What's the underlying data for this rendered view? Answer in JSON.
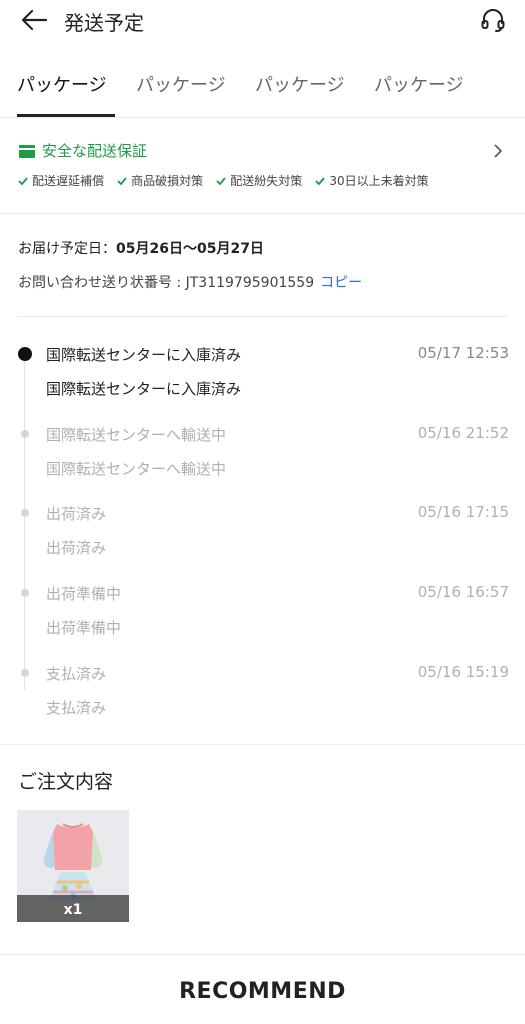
{
  "header": {
    "title": "発送予定",
    "back_icon": "arrow-left-icon",
    "support_icon": "headset-icon"
  },
  "tabs": [
    {
      "label": "パッケージ",
      "active": true
    },
    {
      "label": "パッケージ",
      "active": false
    },
    {
      "label": "パッケージ",
      "active": false
    },
    {
      "label": "パッケージ",
      "active": false
    }
  ],
  "guarantee": {
    "title": "安全な配送保証",
    "accent_color": "#1f9a45",
    "items": [
      "配送遅延補償",
      "商品破損対策",
      "配送紛失対策",
      "30日以上未着対策"
    ]
  },
  "delivery": {
    "estimate_label": "お届け予定日：",
    "estimate_date": "05月26日〜05月27日",
    "tracking_label": "お問い合わせ送り状番号 : ",
    "tracking_number": "JT3119795901559",
    "copy_label": "コピー",
    "link_color": "#2a6fd6"
  },
  "timeline": [
    {
      "status": "国際転送センターに入庫済み",
      "time": "05/17 12:53",
      "detail": "国際転送センターに入庫済み",
      "active": true
    },
    {
      "status": "国際転送センターへ輸送中",
      "time": "05/16 21:52",
      "detail": "国際転送センターへ輸送中",
      "active": false
    },
    {
      "status": "出荷済み",
      "time": "05/16 17:15",
      "detail": "出荷済み",
      "active": false
    },
    {
      "status": "出荷準備中",
      "time": "05/16 16:57",
      "detail": "出荷準備中",
      "active": false
    },
    {
      "status": "支払済み",
      "time": "05/16 15:19",
      "detail": "支払済み",
      "active": false
    }
  ],
  "order": {
    "title": "ご注文内容",
    "quantity": "x1"
  },
  "recommend": {
    "title": "RECOMMEND"
  }
}
